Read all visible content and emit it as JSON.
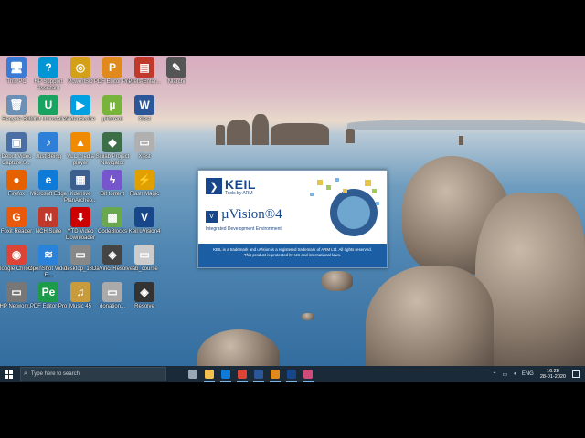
{
  "desktop_icons": [
    {
      "label": "This PC",
      "glyph": "🖥",
      "color": "#3a7bd5"
    },
    {
      "label": "HP Support Assistant",
      "glyph": "?",
      "color": "#0096d6"
    },
    {
      "label": "PowerISO",
      "glyph": "◎",
      "color": "#d4a017"
    },
    {
      "label": "PDF Editor Pro",
      "glyph": "P",
      "color": "#e08a1e"
    },
    {
      "label": "Prefs-Enter...",
      "glyph": "▤",
      "color": "#c0392b"
    },
    {
      "label": "Nlarchi",
      "glyph": "✎",
      "color": "#555555"
    },
    {
      "label": "Recycle Bin",
      "glyph": "🗑",
      "color": "#6b8fb5"
    },
    {
      "label": "IObit Uninstaller",
      "glyph": "U",
      "color": "#1aa260"
    },
    {
      "label": "VideoScribe",
      "glyph": "▶",
      "color": "#00a0e3"
    },
    {
      "label": "µTorrent",
      "glyph": "µ",
      "color": "#78b43c"
    },
    {
      "label": "Xlest",
      "glyph": "W",
      "color": "#2b579a"
    },
    {
      "label": "Debut Video Capture S...",
      "glyph": "▣",
      "color": "#4a6fa5"
    },
    {
      "label": "Just Being",
      "glyph": "♪",
      "color": "#2d7fd8"
    },
    {
      "label": "VLC media player",
      "glyph": "▲",
      "color": "#f08a00"
    },
    {
      "label": "Scilab Project Navigator",
      "glyph": "◆",
      "color": "#3c6e47"
    },
    {
      "label": "Xlest",
      "glyph": "▭",
      "color": "#b0b0b0"
    },
    {
      "label": "Firefox",
      "glyph": "●",
      "color": "#e66000"
    },
    {
      "label": "Microsoft Edge",
      "glyph": "e",
      "color": "#0f7bd8"
    },
    {
      "label": "Kdenlive PlanArcheo...",
      "glyph": "▦",
      "color": "#3d5f8f"
    },
    {
      "label": "Bit torrent",
      "glyph": "ϟ",
      "color": "#7755cc"
    },
    {
      "label": "Flash Magic",
      "glyph": "⚡",
      "color": "#e0a000"
    },
    {
      "label": "Foxit Reader",
      "glyph": "G",
      "color": "#e8590c"
    },
    {
      "label": "NCH Suite",
      "glyph": "N",
      "color": "#c0392b"
    },
    {
      "label": "YTD Video Downloader",
      "glyph": "⬇",
      "color": "#cc0000"
    },
    {
      "label": "CodeBlocks",
      "glyph": "▩",
      "color": "#6aa84f"
    },
    {
      "label": "Keil uVision4",
      "glyph": "V",
      "color": "#17478a"
    },
    {
      "label": "Google Chrome",
      "glyph": "◉",
      "color": "#db4437"
    },
    {
      "label": "OpenShot Video E...",
      "glyph": "≋",
      "color": "#2a82da"
    },
    {
      "label": "desktop_13...",
      "glyph": "▭",
      "color": "#888888"
    },
    {
      "label": "DaVinci Resolve",
      "glyph": "◈",
      "color": "#444444"
    },
    {
      "label": "lab_course",
      "glyph": "▭",
      "color": "#cccccc"
    },
    {
      "label": "HP Network...",
      "glyph": "▭",
      "color": "#777777"
    },
    {
      "label": "PDF Editor Pro",
      "glyph": "Pe",
      "color": "#1d9a4a"
    },
    {
      "label": "Music 45",
      "glyph": "♫",
      "color": "#c89b3c"
    },
    {
      "label": "donation...",
      "glyph": "▭",
      "color": "#aaaaaa"
    },
    {
      "label": "Resolve",
      "glyph": "◈",
      "color": "#333333"
    }
  ],
  "splash": {
    "brand": "KEIL",
    "brand_sub": "Tools by ARM",
    "product": "µVision®4",
    "product_sub": "Integrated Development Environment",
    "legal_1": "KEIL is a trademark and uVision is a registered trademark of ARM Ltd. All rights reserved.",
    "legal_2": "This product is protected by US and international laws."
  },
  "taskbar": {
    "search_placeholder": "Type here to search",
    "apps": [
      {
        "name": "task-view",
        "color": "#9aa8b5"
      },
      {
        "name": "file-explorer",
        "color": "#f2c14e"
      },
      {
        "name": "edge",
        "color": "#0f7bd8"
      },
      {
        "name": "chrome",
        "color": "#db4437"
      },
      {
        "name": "word",
        "color": "#2b579a"
      },
      {
        "name": "pdf",
        "color": "#e08a1e"
      },
      {
        "name": "keil",
        "color": "#17478a"
      },
      {
        "name": "app",
        "color": "#d04a7a"
      }
    ],
    "tray_language": "ENG",
    "time": "16:28",
    "date": "28-01-2020"
  }
}
